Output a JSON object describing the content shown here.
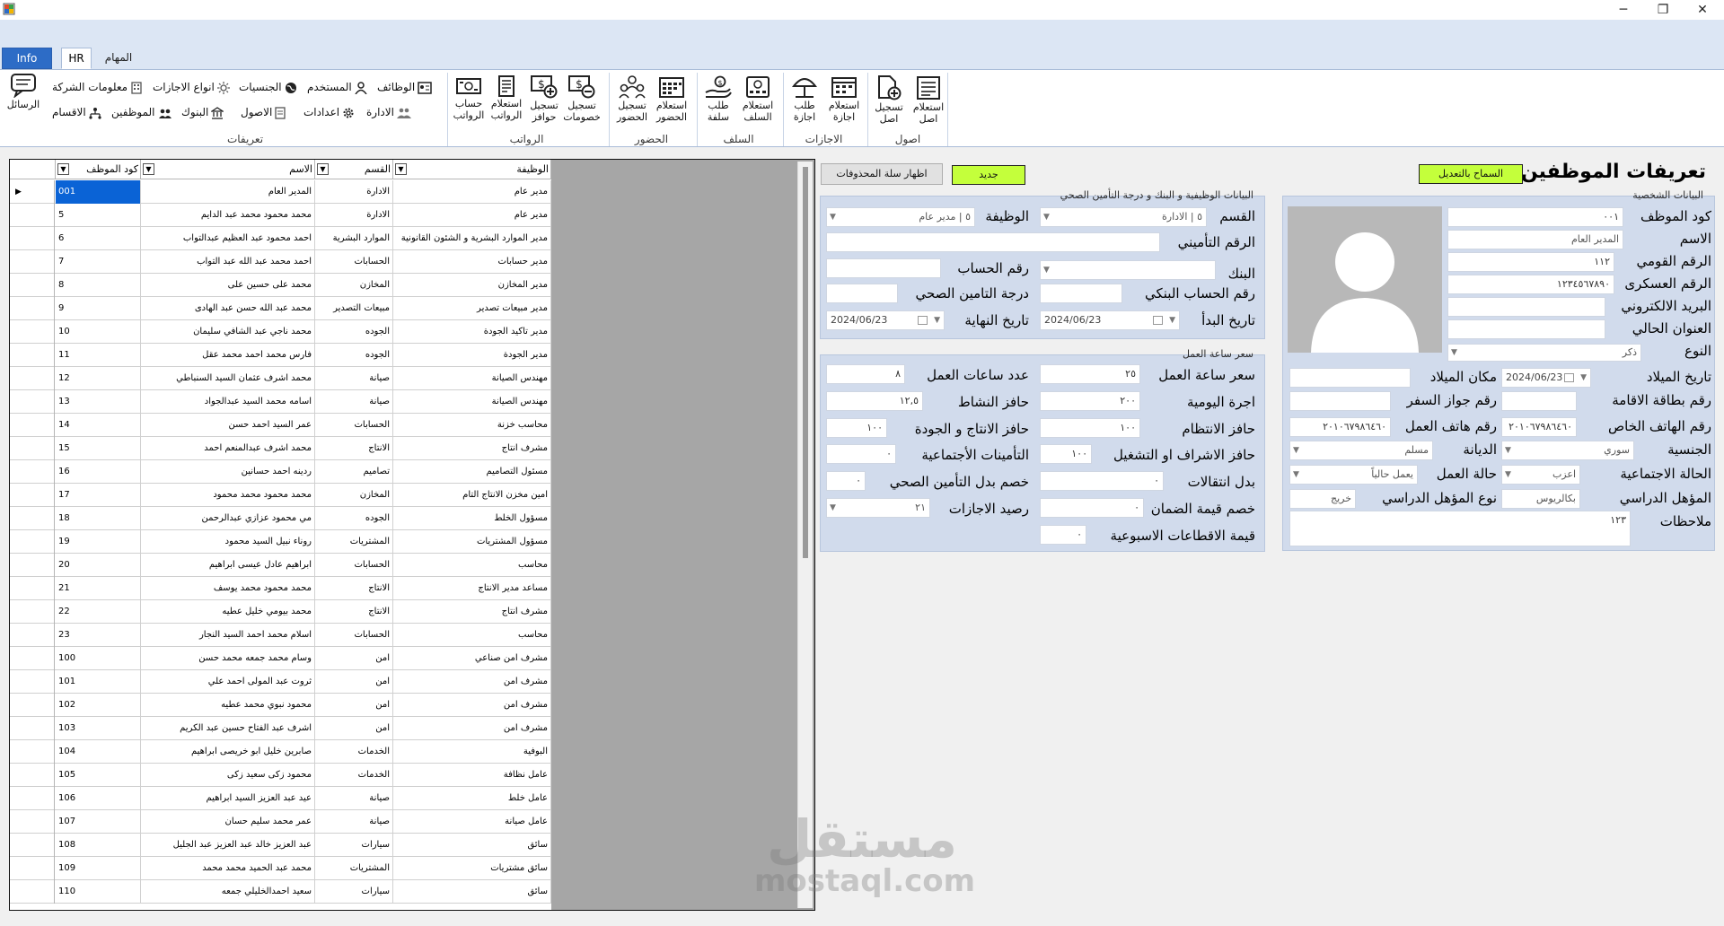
{
  "window": {
    "minimize": "─",
    "maximize": "❐",
    "close": "✕"
  },
  "tabs": {
    "info": "Info",
    "hr": "HR",
    "tasks": "المهام"
  },
  "ribbon": {
    "messages": "الرسائل",
    "groups": {
      "definitions": "تعريفات",
      "salaries": "الرواتب",
      "attendance": "الحضور",
      "advances": "السلف",
      "vacations": "الاجازات",
      "assets": "اصول"
    },
    "definitions_items": {
      "jobs": "الوظائف",
      "user": "المستخدم",
      "nationalities": "الجنسيات",
      "vacation_types": "انواع الاجازات",
      "company_info": "معلومات الشركة",
      "administration": "الادارة",
      "settings": "اعدادات",
      "assets": "الاصول",
      "banks": "البنوك",
      "employees": "الموظفين",
      "departments": "الاقسام"
    },
    "big": {
      "calc_salaries": [
        "حساب",
        "الرواتب"
      ],
      "query_salaries": [
        "استعلام",
        "الرواتب"
      ],
      "record_incentives": [
        "تسجيل",
        "حوافز"
      ],
      "record_deductions": [
        "تسجيل",
        "خصومات"
      ],
      "record_attendance": [
        "تسجيل",
        "الحضور"
      ],
      "query_attendance": [
        "استعلام",
        "الحضور"
      ],
      "request_advance": [
        "طلب",
        "سلفة"
      ],
      "query_advances": [
        "استعلام",
        "السلف"
      ],
      "request_vacation": [
        "طلب",
        "اجازة"
      ],
      "query_vacation": [
        "استعلام",
        "اجازة"
      ],
      "record_asset": [
        "تسجيل",
        "اصل"
      ],
      "query_asset": [
        "استعلام",
        "اصل"
      ]
    }
  },
  "grid": {
    "headers": {
      "code": "كود الموظف",
      "name": "الاسم",
      "dept": "القسم",
      "job": "الوظيفة"
    },
    "rows": [
      {
        "code": "001",
        "name": "المدير العام",
        "dept": "الادارة",
        "job": "مدير عام"
      },
      {
        "code": "5",
        "name": "محمد محمود محمد عبد الدايم",
        "dept": "الادارة",
        "job": "مدير عام"
      },
      {
        "code": "6",
        "name": "احمد محمود عبد العظيم عبدالتواب",
        "dept": "الموارد البشرية",
        "job": "مدير الموارد البشرية و الشئون القانونية"
      },
      {
        "code": "7",
        "name": "احمد محمد عبد الله عبد التواب",
        "dept": "الحسابات",
        "job": "مدير حسابات"
      },
      {
        "code": "8",
        "name": "محمد على حسين على",
        "dept": "المخازن",
        "job": "مدير المخازن"
      },
      {
        "code": "9",
        "name": "محمد عبد الله حسن عبد الهادى",
        "dept": "مبيعات التصدير",
        "job": "مدير مبيعات تصدير"
      },
      {
        "code": "10",
        "name": "محمد ناجي عبد الشافي سليمان",
        "dept": "الجوده",
        "job": "مدير تاكيد الجودة"
      },
      {
        "code": "11",
        "name": "فارس محمد احمد محمد عقل",
        "dept": "الجوده",
        "job": "مدير الجودة"
      },
      {
        "code": "12",
        "name": "محمد اشرف عثمان السيد السنباطي",
        "dept": "صيانة",
        "job": "مهندس الصيانة"
      },
      {
        "code": "13",
        "name": "اسامه محمد السيد عبدالجواد",
        "dept": "صيانة",
        "job": "مهندس الصيانة"
      },
      {
        "code": "14",
        "name": "عمر السيد احمد حسن",
        "dept": "الحسابات",
        "job": "محاسب خزنة"
      },
      {
        "code": "15",
        "name": "محمد اشرف عبدالمنعم احمد",
        "dept": "الانتاج",
        "job": "مشرف انتاج"
      },
      {
        "code": "16",
        "name": "ردينه احمد حسانين",
        "dept": "تصاميم",
        "job": "مسئول التصاميم"
      },
      {
        "code": "17",
        "name": "محمد محمود محمد محمود",
        "dept": "المخازن",
        "job": "امين مخزن الانتاج التام"
      },
      {
        "code": "18",
        "name": "مي محمود عزازي عبدالرحمن",
        "dept": "الجوده",
        "job": "مسؤول الخلط"
      },
      {
        "code": "19",
        "name": "روناء نبيل السيد محمود",
        "dept": "المشتريات",
        "job": "مسؤول المشتريات"
      },
      {
        "code": "20",
        "name": "ابراهيم عادل عيسى ابراهيم",
        "dept": "الحسابات",
        "job": "محاسب"
      },
      {
        "code": "21",
        "name": "محمد محمود محمد يوسف",
        "dept": "الانتاج",
        "job": "مساعد مدير الانتاج"
      },
      {
        "code": "22",
        "name": "محمد بيومي خليل عطيه",
        "dept": "الانتاج",
        "job": "مشرف انتاج"
      },
      {
        "code": "23",
        "name": "اسلام محمد احمد السيد النجار",
        "dept": "الحسابات",
        "job": "محاسب"
      },
      {
        "code": "100",
        "name": "وسام محمد جمعه محمد حسن",
        "dept": "امن",
        "job": "مشرف امن صناعي"
      },
      {
        "code": "101",
        "name": "ثروت عبد المولى احمد علي",
        "dept": "امن",
        "job": "مشرف امن"
      },
      {
        "code": "102",
        "name": "محمود نبوي محمد عطيه",
        "dept": "امن",
        "job": "مشرف امن"
      },
      {
        "code": "103",
        "name": "اشرف عبد الفتاح حسين عبد الكريم",
        "dept": "امن",
        "job": "مشرف امن"
      },
      {
        "code": "104",
        "name": "صابرين خليل ابو خريصى ابراهيم",
        "dept": "الخدمات",
        "job": "البوفية"
      },
      {
        "code": "105",
        "name": "محمود زكى سعيد زكى",
        "dept": "الخدمات",
        "job": "عامل نظافة"
      },
      {
        "code": "106",
        "name": "عيد عبد العزيز السيد ابراهيم",
        "dept": "صيانة",
        "job": "عامل خلط"
      },
      {
        "code": "107",
        "name": "عمر محمد سليم حسان",
        "dept": "صيانة",
        "job": "عامل صيانة"
      },
      {
        "code": "108",
        "name": "عبد العزيز خالد عبد العزيز عبد الجليل",
        "dept": "سيارات",
        "job": "سائق"
      },
      {
        "code": "109",
        "name": "محمد عبد الحميد محمد محمد",
        "dept": "المشتريات",
        "job": "سائق مشتريات"
      },
      {
        "code": "110",
        "name": "سعيد احمدالخليلي جمعه",
        "dept": "سيارات",
        "job": "سائق"
      }
    ]
  },
  "form": {
    "title": "تعريفات الموظفين",
    "allow_edit": "السماح بالتعديل",
    "new": "جديد",
    "show_deleted": "اظهار سلة المحذوفات",
    "personal": {
      "caption": "البيانات الشخصية",
      "code_label": "كود الموظف",
      "code": "٠٠١",
      "name_label": "الاسم",
      "name": "المدير العام",
      "national_label": "الرقم القومي",
      "national": "١١٢",
      "military_label": "الرقم العسكرى",
      "military": "١٢٣٤٥٦٧٨٩٠",
      "email_label": "البريد الالكتروني",
      "address_label": "العنوان الحالي",
      "gender_label": "النوع",
      "gender": "ذكر",
      "birthdate_label": "تاريخ الميلاد",
      "birthdate": "2024/06/23",
      "birthplace_label": "مكان الميلاد",
      "residence_label": "رقم بطاقة الاقامة",
      "passport_label": "رقم جواز السفر",
      "mobile_label": "رقم الهاتف الخاص",
      "mobile": "٢٠١٠٦٧٩٨٦٤٦٠",
      "work_phone_label": "رقم هاتف العمل",
      "work_phone": "٢٠١٠٦٧٩٨٦٤٦٠",
      "nationality_label": "الجنسية",
      "nationality": "سوري",
      "religion_label": "الديانة",
      "religion": "مسلم",
      "marital_label": "الحالة الاجتماعية",
      "marital": "اعزب",
      "work_status_label": "حالة العمل",
      "work_status": "يعمل حالياً",
      "qualification_label": "المؤهل الدراسي",
      "qualification": "بكالريوس",
      "qualification_type_label": "نوع المؤهل الدراسي",
      "qualification_type": "خريج",
      "notes_label": "ملاحظات",
      "notes": "١٢٣"
    },
    "job": {
      "caption": "البيانات الوظيفية و البنك و درجة التأمين الصحي",
      "dept_label": "القسم",
      "dept": "٥ | الادارة",
      "job_label": "الوظيفة",
      "job": "٥ | مدير عام",
      "insurance_no_label": "الرقم التأميني",
      "bank_label": "البنك",
      "account_label": "رقم الحساب",
      "bank_account_label": "رقم الحساب البنكي",
      "health_label": "درجة التامين الصحي",
      "start_label": "تاريخ البدأ",
      "start": "2024/06/23",
      "end_label": "تاريخ النهاية",
      "end": "2024/06/23"
    },
    "hour": {
      "caption": "سعر ساعة العمل",
      "hour_rate_label": "سعر ساعة العمل",
      "hour_rate": "٢٥",
      "hours_label": "عدد ساعات العمل",
      "hours": "٨",
      "daily_label": "اجرة اليومية",
      "daily": "٢٠٠",
      "activity_label": "حافز النشاط",
      "activity": "١٢,٥",
      "discipline_label": "حافز الانتظام",
      "discipline": "١٠٠",
      "production_label": "حافز الانتاج و الجودة",
      "production": "١٠٠",
      "supervision_label": "حافز الاشراف او التشغيل",
      "supervision": "١٠٠",
      "social_label": "التأمينات الأجتماعية",
      "social": "٠",
      "transport_label": "بدل انتقالات",
      "transport": "٠",
      "health_deduct_label": "خصم بدل التأمين الصحي",
      "health_deduct": "٠",
      "guarantee_label": "خصم قيمة الضمان",
      "guarantee": "٠",
      "vacation_balance_label": "رصيد الاجازات",
      "vacation_balance": "٢١",
      "weekly_label": "قيمة الاقطاعات الاسبوعية",
      "weekly": "٠"
    }
  },
  "watermark": {
    "ar": "مستقل",
    "en": "mostaql.com"
  }
}
